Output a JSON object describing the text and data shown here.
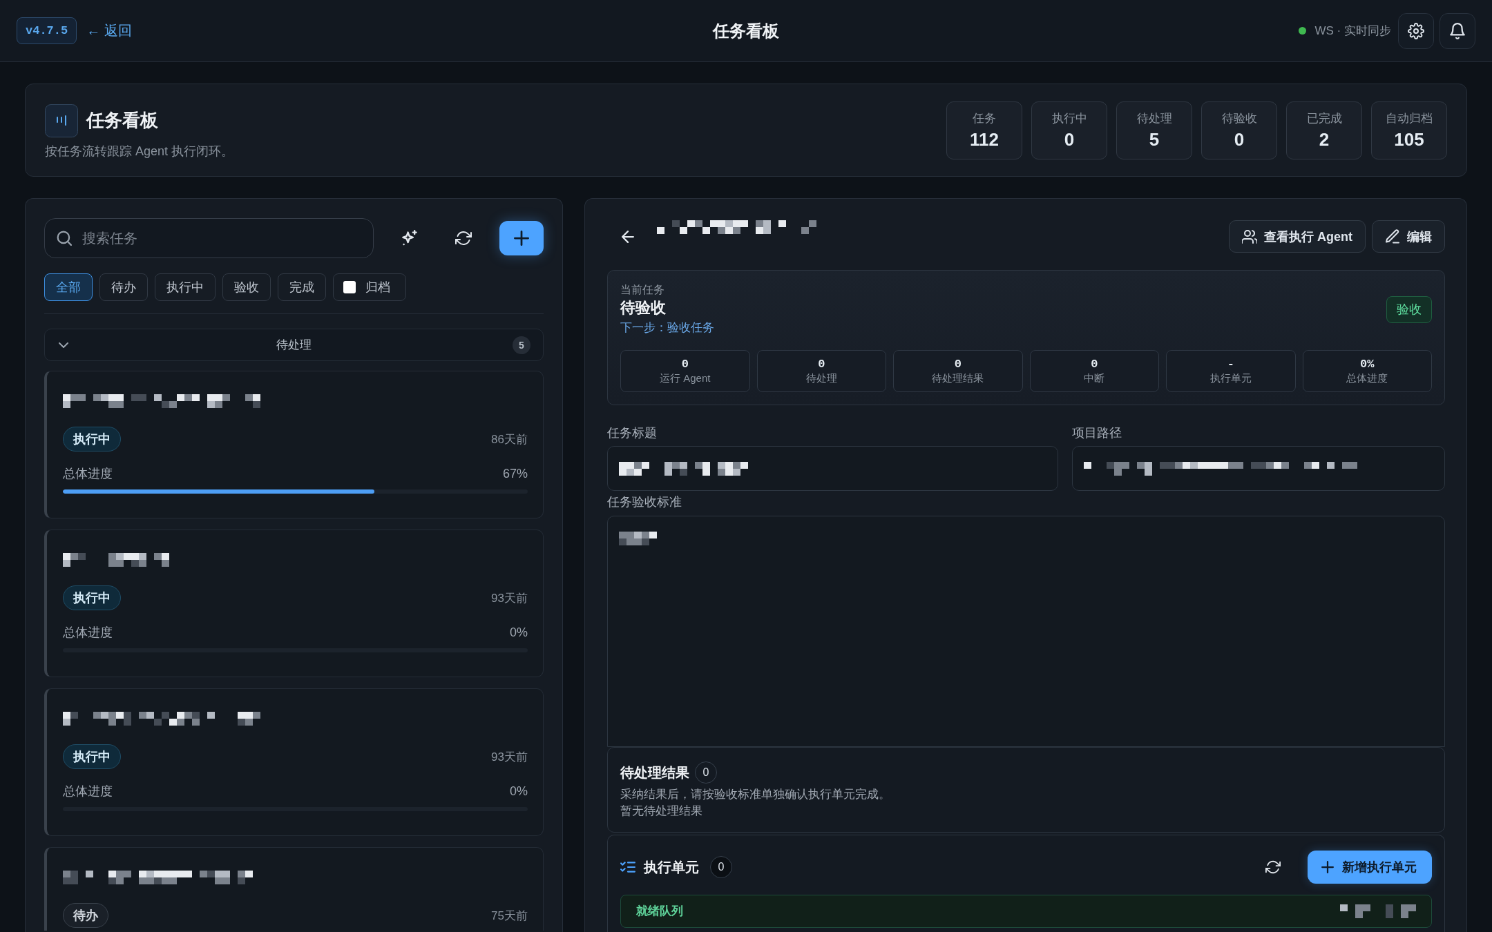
{
  "top_bar": {
    "version": "v4.7.5",
    "back_link": "← 返回",
    "title": "任务看板",
    "connection": {
      "connected": true,
      "label": "WS · 实时同步"
    }
  },
  "header": {
    "title": "任务看板",
    "subtitle": "按任务流转跟踪 Agent 执行闭环。",
    "stats": [
      {
        "label": "任务",
        "value": "112"
      },
      {
        "label": "执行中",
        "value": "0"
      },
      {
        "label": "待处理",
        "value": "5"
      },
      {
        "label": "待验收",
        "value": "0"
      },
      {
        "label": "已完成",
        "value": "2"
      },
      {
        "label": "自动归档",
        "value": "105"
      }
    ]
  },
  "task_list": {
    "search": {
      "placeholder": "搜索任务"
    },
    "filters": [
      {
        "kind": "chip",
        "label": "全部",
        "selected": true
      },
      {
        "kind": "chip",
        "label": "待办",
        "selected": false
      },
      {
        "kind": "chip",
        "label": "执行中",
        "selected": false
      },
      {
        "kind": "chip",
        "label": "验收",
        "selected": false
      },
      {
        "kind": "chip",
        "label": "完成",
        "selected": false
      },
      {
        "kind": "checkbox",
        "label": "归档",
        "checked": false
      }
    ],
    "group": {
      "label": "待处理",
      "count": "5",
      "expanded": true
    },
    "tasks": [
      {
        "status": {
          "kind": "running",
          "label": "执行中"
        },
        "time": "86天前",
        "progress": {
          "label": "总体进度",
          "reading": "67%",
          "level": 0.67
        }
      },
      {
        "status": {
          "kind": "running",
          "label": "执行中"
        },
        "time": "93天前",
        "progress": {
          "label": "总体进度",
          "reading": "0%",
          "level": 0
        }
      },
      {
        "status": {
          "kind": "running",
          "label": "执行中"
        },
        "time": "93天前",
        "progress": {
          "label": "总体进度",
          "reading": "0%",
          "level": 0
        }
      },
      {
        "status": {
          "kind": "todo",
          "label": "待办"
        },
        "time": "75天前"
      }
    ]
  },
  "detail": {
    "actions": [
      {
        "kind": "agents",
        "label": "查看执行 Agent"
      },
      {
        "kind": "edit",
        "label": "编辑"
      }
    ],
    "current": {
      "caption": "当前任务",
      "state": "待验收",
      "next_step": "下一步：验收任务",
      "badge": "验收",
      "metrics": [
        {
          "value": "0",
          "label": "运行 Agent"
        },
        {
          "value": "0",
          "label": "待处理"
        },
        {
          "value": "0",
          "label": "待处理结果"
        },
        {
          "value": "0",
          "label": "中断"
        },
        {
          "value": "-",
          "label": "执行单元"
        },
        {
          "value": "0%",
          "label": "总体进度"
        }
      ]
    },
    "fields": [
      {
        "label": "任务标题"
      },
      {
        "label": "项目路径"
      }
    ],
    "criteria": {
      "label": "任务验收标准"
    },
    "pending_results": {
      "title": "待处理结果",
      "count": "0",
      "note": "采纳结果后，请按验收标准单独确认执行单元完成。",
      "empty": "暂无待处理结果"
    },
    "units": {
      "title": "执行单元",
      "count": "0",
      "add_button": "新增执行单元",
      "queues": [
        {
          "label": "就绪队列"
        }
      ]
    }
  }
}
